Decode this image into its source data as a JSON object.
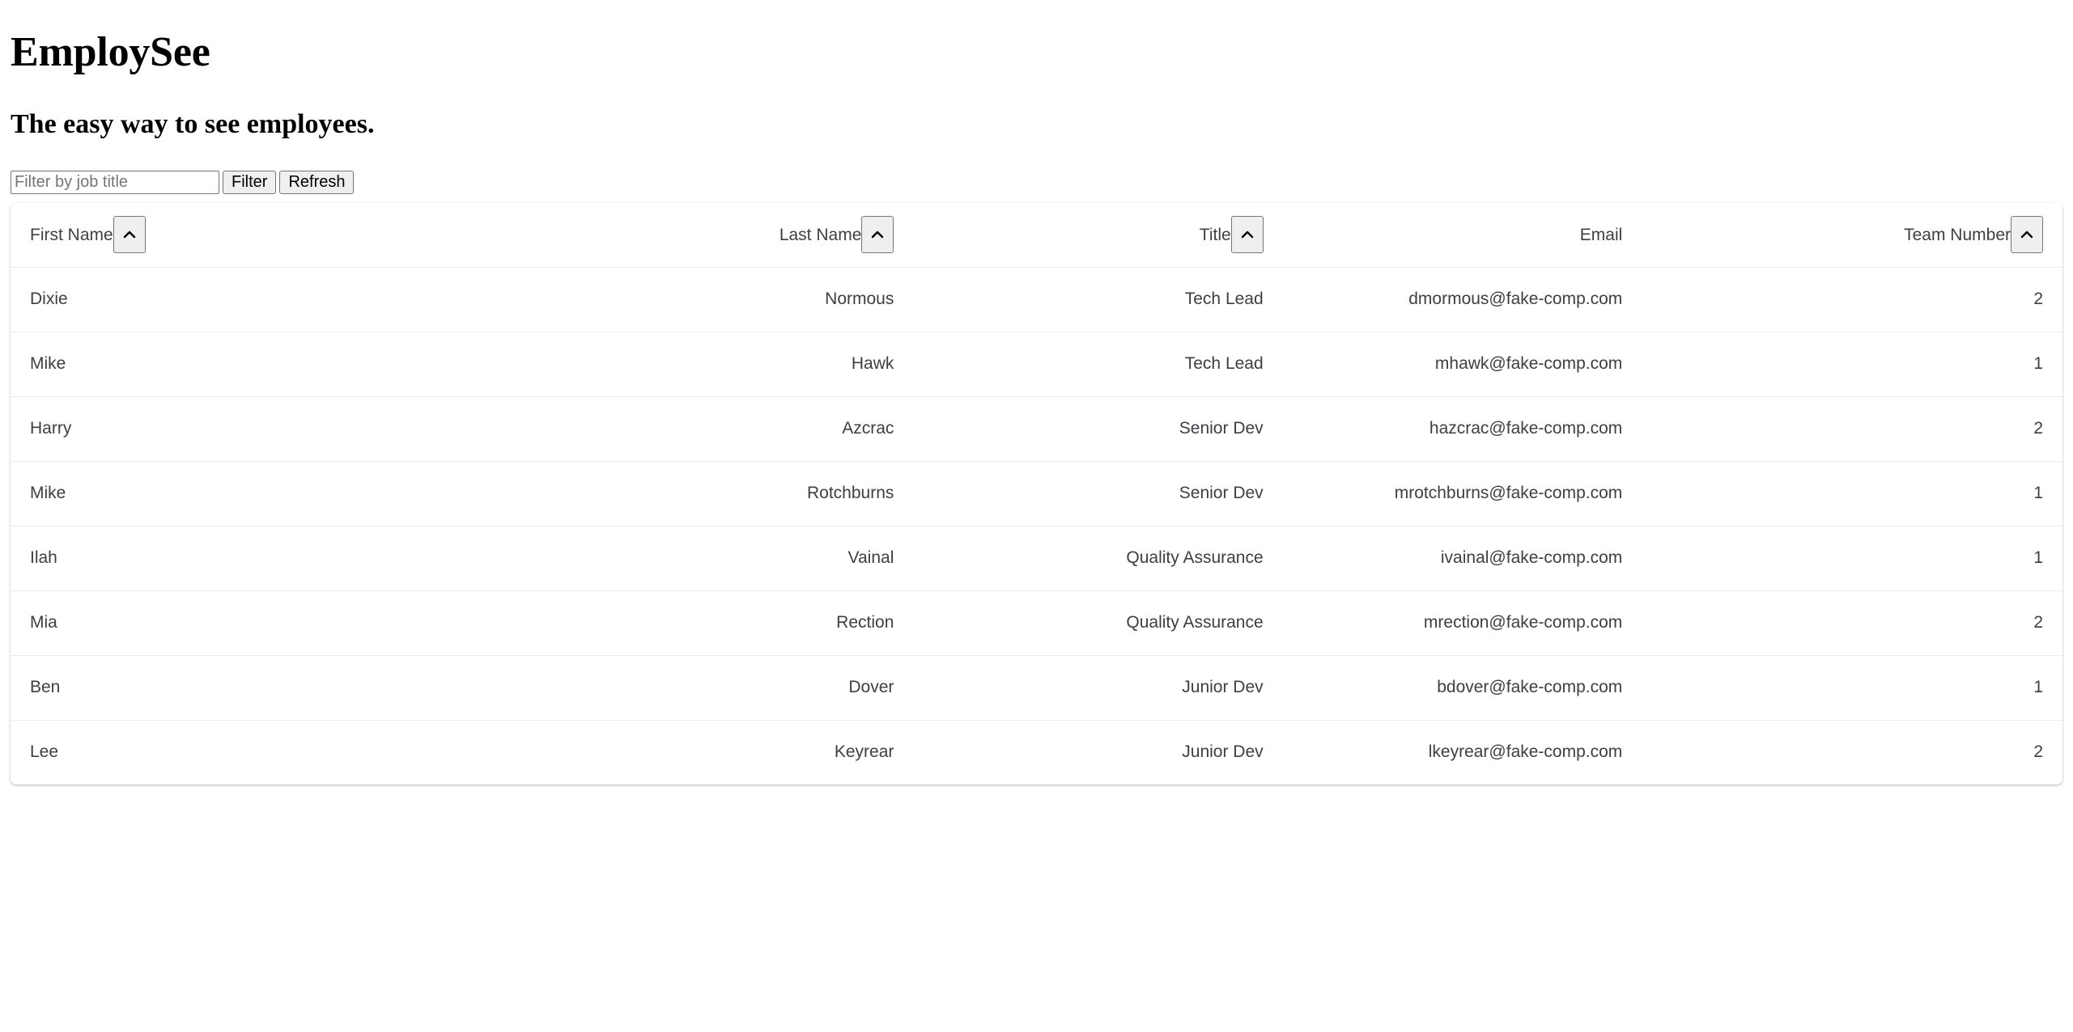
{
  "app": {
    "title": "EmploySee",
    "subtitle": "The easy way to see employees."
  },
  "filter_bar": {
    "input_value": "",
    "input_placeholder": "Filter by job title",
    "filter_button": "Filter",
    "refresh_button": "Refresh"
  },
  "table": {
    "columns": [
      {
        "label": "First Name",
        "align": "left",
        "sortable": true,
        "sort_icon": "chevron-up-icon"
      },
      {
        "label": "Last Name",
        "align": "right",
        "sortable": true,
        "sort_icon": "chevron-up-icon"
      },
      {
        "label": "Title",
        "align": "right",
        "sortable": true,
        "sort_icon": "chevron-up-icon"
      },
      {
        "label": "Email",
        "align": "right",
        "sortable": false,
        "sort_icon": ""
      },
      {
        "label": "Team Number",
        "align": "right",
        "sortable": true,
        "sort_icon": "chevron-up-icon"
      }
    ],
    "rows": [
      {
        "first_name": "Dixie",
        "last_name": "Normous",
        "title": "Tech Lead",
        "email": "dmormous@fake-comp.com",
        "team_number": "2"
      },
      {
        "first_name": "Mike",
        "last_name": "Hawk",
        "title": "Tech Lead",
        "email": "mhawk@fake-comp.com",
        "team_number": "1"
      },
      {
        "first_name": "Harry",
        "last_name": "Azcrac",
        "title": "Senior Dev",
        "email": "hazcrac@fake-comp.com",
        "team_number": "2"
      },
      {
        "first_name": "Mike",
        "last_name": "Rotchburns",
        "title": "Senior Dev",
        "email": "mrotchburns@fake-comp.com",
        "team_number": "1"
      },
      {
        "first_name": "Ilah",
        "last_name": "Vainal",
        "title": "Quality Assurance",
        "email": "ivainal@fake-comp.com",
        "team_number": "1"
      },
      {
        "first_name": "Mia",
        "last_name": "Rection",
        "title": "Quality Assurance",
        "email": "mrection@fake-comp.com",
        "team_number": "2"
      },
      {
        "first_name": "Ben",
        "last_name": "Dover",
        "title": "Junior Dev",
        "email": "bdover@fake-comp.com",
        "team_number": "1"
      },
      {
        "first_name": "Lee",
        "last_name": "Keyrear",
        "title": "Junior Dev",
        "email": "lkeyrear@fake-comp.com",
        "team_number": "2"
      }
    ]
  },
  "colors": {
    "page_background": "#ffffff",
    "card_background": "#ffffff",
    "text": "#3c4043",
    "heading": "#000000",
    "row_divider": "#e8eaed",
    "button_face": "#efefef",
    "button_border": "#767676",
    "placeholder": "#757575"
  }
}
